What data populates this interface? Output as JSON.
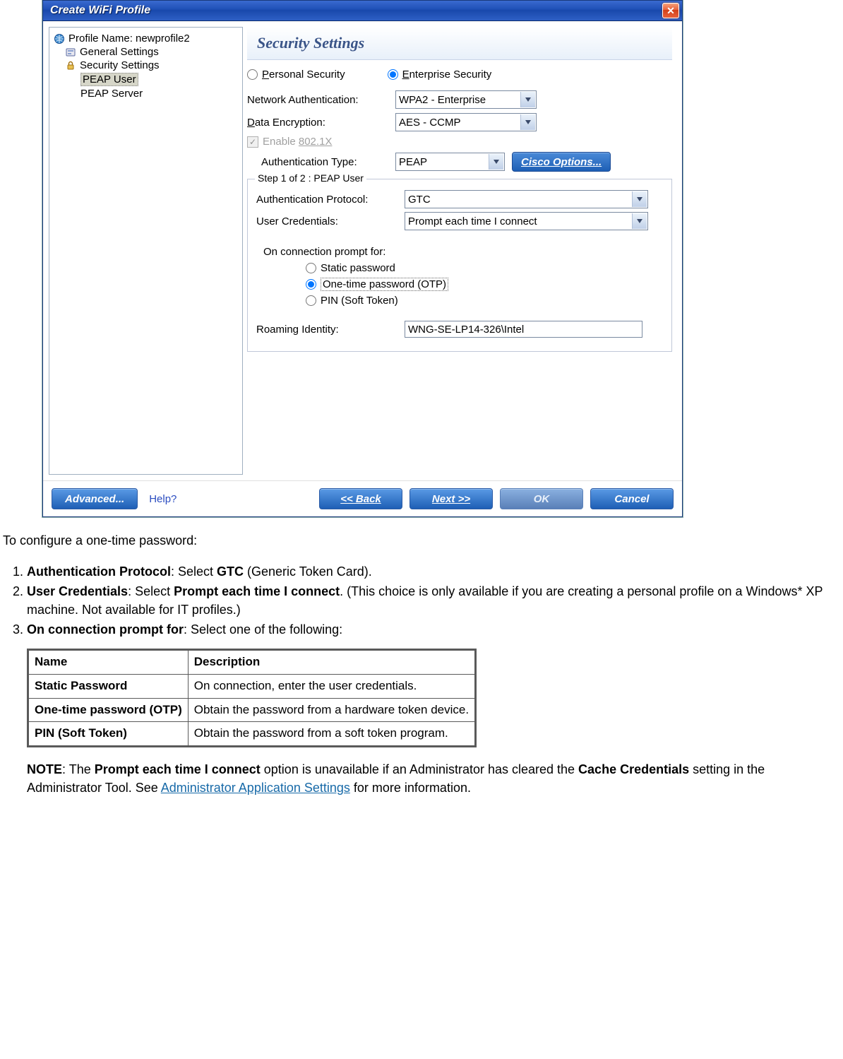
{
  "dialog": {
    "title": "Create WiFi Profile",
    "tree": {
      "profile_label": "Profile Name: newprofile2",
      "general": "General Settings",
      "security": "Security Settings",
      "peap_user": "PEAP User",
      "peap_server": "PEAP Server"
    },
    "header": "Security Settings",
    "radio_personal": "Personal Security",
    "radio_enterprise": "Enterprise Security",
    "net_auth_label": "Network Authentication:",
    "net_auth_value": "WPA2 - Enterprise",
    "data_enc_label": "Data Encryption:",
    "data_enc_value": "AES - CCMP",
    "enable_8021x": "Enable 802.1X",
    "auth_type_label": "Authentication Type:",
    "auth_type_value": "PEAP",
    "cisco_btn": "Cisco Options...",
    "step_legend": "Step 1 of 2 : PEAP User",
    "auth_proto_label": "Authentication Protocol:",
    "auth_proto_value": "GTC",
    "user_cred_label": "User Credentials:",
    "user_cred_value": "Prompt each time I connect",
    "prompt_label": "On connection prompt for:",
    "prompt_static": "Static password",
    "prompt_otp": "One-time password (OTP)",
    "prompt_pin": "PIN (Soft Token)",
    "roaming_label": "Roaming Identity:",
    "roaming_value": "WNG-SE-LP14-326\\Intel",
    "buttons": {
      "advanced": "Advanced...",
      "help": "Help?",
      "back": "<< Back",
      "next": "Next >>",
      "ok": "OK",
      "cancel": "Cancel"
    }
  },
  "doc": {
    "intro": "To configure a one-time password:",
    "steps": [
      {
        "b1": "Authentication Protocol",
        "t1": ": Select ",
        "b2": "GTC",
        "t2": " (Generic Token Card)."
      },
      {
        "b1": "User Credentials",
        "t1": ": Select ",
        "b2": "Prompt each time I connect",
        "t2": ". (This choice is only available if you are creating a personal profile on a Windows* XP machine. Not available for IT profiles.)"
      },
      {
        "b1": "On connection prompt for",
        "t1": ": Select one of the following:",
        "b2": "",
        "t2": ""
      }
    ],
    "table": {
      "h1": "Name",
      "h2": "Description",
      "rows": [
        {
          "n": "Static Password",
          "d": "On connection, enter the user credentials."
        },
        {
          "n": "One-time password (OTP)",
          "d": "Obtain the password from a hardware token device."
        },
        {
          "n": "PIN (Soft Token)",
          "d": "Obtain the password from a soft token program."
        }
      ]
    },
    "note": {
      "label": "NOTE",
      "t1": ": The ",
      "b1": "Prompt each time I connect",
      "t2": " option is unavailable if an Administrator has cleared the ",
      "b2": "Cache Credentials",
      "t3": " setting in the Administrator Tool. See ",
      "link": "Administrator Application Settings",
      "t4": " for more information."
    }
  }
}
